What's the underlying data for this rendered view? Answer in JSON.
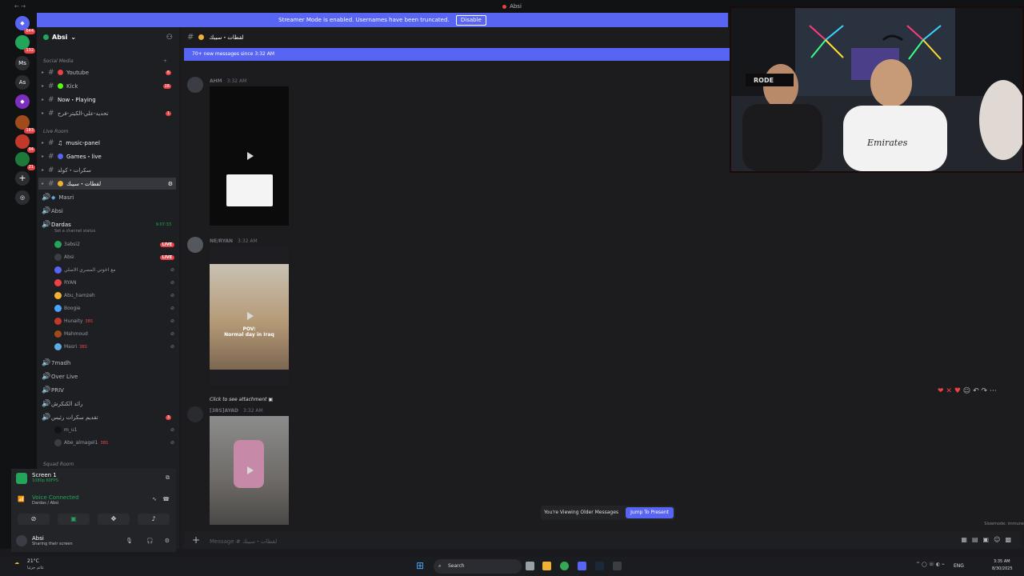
{
  "window": {
    "title": "Absi"
  },
  "streamer_banner": {
    "text": "Streamer Mode is enabled. Usernames have been truncated.",
    "button": "Disable"
  },
  "servers": [
    {
      "label": "Ms"
    },
    {
      "label": "As"
    }
  ],
  "server_badges": [
    "644",
    "132",
    "183",
    "94",
    "21"
  ],
  "guild": {
    "name": "Absi"
  },
  "categories": {
    "social": "Social Media",
    "live": "Live Room",
    "squad": "Squad Room"
  },
  "channels": {
    "youtube": {
      "label": "Youtube",
      "count": "6"
    },
    "kick": {
      "label": "Kick",
      "count": "16"
    },
    "now_playing": {
      "label": "Now・Playing"
    },
    "arabic1": {
      "label": "تحديد-علي-الكيتر-فرح",
      "count": "1"
    },
    "music_panel": {
      "label": "music-panel"
    },
    "games_live": {
      "label": "Games・live"
    },
    "skrat": {
      "label": "سكرات・كولد"
    },
    "active": {
      "label": "لقطات・سيبك"
    },
    "masri": {
      "label": "Masri"
    },
    "absi": {
      "label": "Absi"
    },
    "dardas": {
      "label": "Dardas",
      "timer": "9:07:33",
      "status": "Set a channel status"
    },
    "7madh": {
      "label": "7madh"
    },
    "over_live": {
      "label": "Over Live"
    },
    "prv": {
      "label": "PRIV"
    },
    "arabic2": {
      "label": "رائد الكنكرش"
    },
    "arabic3": {
      "label": "تقديم سكرات رئيس",
      "count": "3"
    }
  },
  "voice_users": [
    {
      "name": "3absi2",
      "live": "LIVE"
    },
    {
      "name": "Absi",
      "live": "LIVE"
    },
    {
      "name": "مع اخوتي المصري الاصلي"
    },
    {
      "name": "RYAN"
    },
    {
      "name": "Abu_hamzeh"
    },
    {
      "name": "Boogie"
    },
    {
      "name": "Hunaity",
      "tag": "3BS"
    },
    {
      "name": "Mahmoud"
    },
    {
      "name": "Masri",
      "tag": "3BS"
    }
  ],
  "voice_users2": [
    {
      "name": "m_u1"
    },
    {
      "name": "Abe_almagel1",
      "tag": "3BS"
    }
  ],
  "screen_panel": {
    "title": "Screen 1",
    "sub": "1080p 60FPS"
  },
  "voice_panel": {
    "status": "Voice Connected",
    "channel": "Dardas / Absi"
  },
  "user_panel": {
    "name": "Absi",
    "status": "Sharing their screen"
  },
  "chat": {
    "header": "لقطات・سيبك",
    "new_banner": "70+ new messages since 3:32 AM",
    "msgs": [
      {
        "author": "AHM",
        "time": "3:32 AM"
      },
      {
        "author": "NE/RYAN",
        "time": "3:32 AM",
        "caption1": "POV:",
        "caption2": "Normal day in Iraq"
      },
      {
        "author": "[3BS]AYAD",
        "time": "3:32 AM"
      }
    ],
    "reply": "Click to see attachment",
    "older": "You're Viewing Older Messages",
    "jump": "Jump To Present",
    "composer": "Message # لقطات・سيبك",
    "slowmode": "Slowmode: immune"
  },
  "webcam": {
    "mic_label": "RODE",
    "shirt": "Emirates"
  },
  "taskbar": {
    "weather_temp": "21°C",
    "weather_desc": "غائم جزئيا",
    "search": "Search",
    "lang": "ENG",
    "time": "3:35 AM",
    "date": "8/30/2025"
  }
}
